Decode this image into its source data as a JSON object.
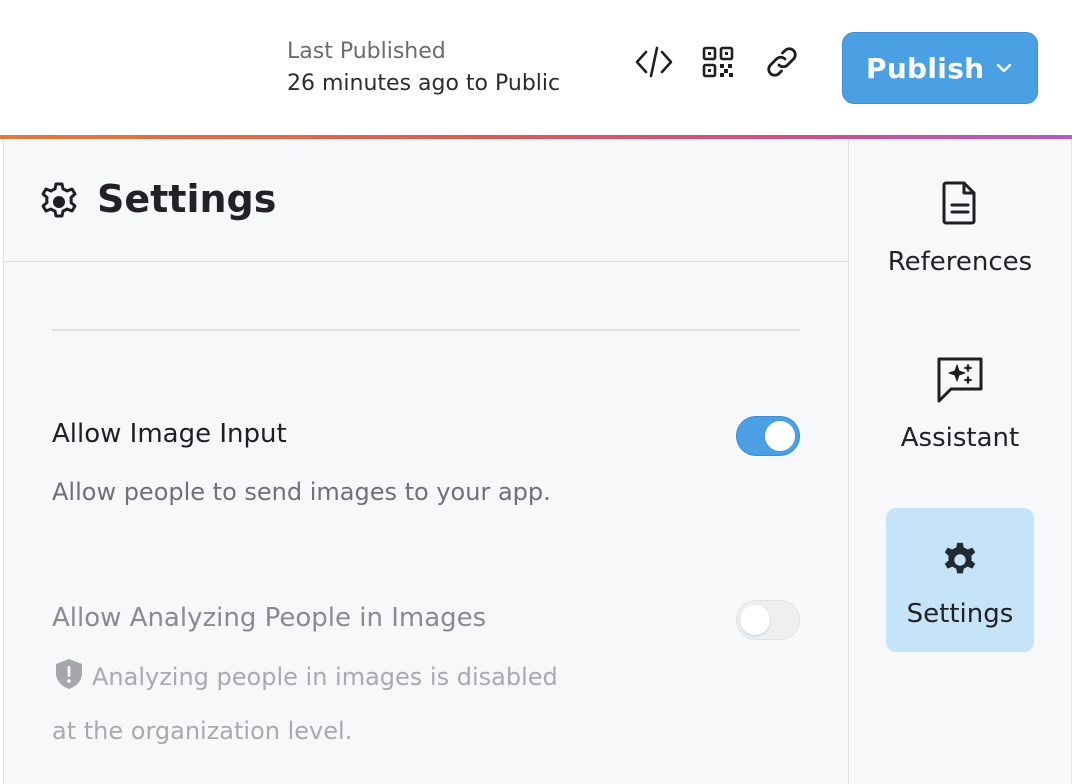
{
  "header": {
    "last_published_label": "Last Published",
    "publish_status": "26 minutes ago to Public",
    "icons": [
      "code-icon",
      "qr-code-icon",
      "link-icon"
    ],
    "publish_button": {
      "label": "Publish",
      "color": "#4b9fe3"
    }
  },
  "panel": {
    "title": "Settings",
    "settings": [
      {
        "title": "Allow Image Input",
        "description": "Allow people to send images to your app.",
        "enabled": true,
        "disabled": false
      },
      {
        "title": "Allow Analyzing People in Images",
        "description_line1": "Analyzing people in images is disabled",
        "description_line2": "at the organization level.",
        "enabled": false,
        "disabled": true
      }
    ]
  },
  "sidebar": {
    "items": [
      {
        "label": "References",
        "icon": "document-icon",
        "active": false
      },
      {
        "label": "Assistant",
        "icon": "sparkle-chat-icon",
        "active": false
      },
      {
        "label": "Settings",
        "icon": "gear-icon",
        "active": true
      }
    ],
    "active_color": "#c6e4f8"
  },
  "colors": {
    "accent": "#4b9fe3",
    "gradient": [
      "#e07a3b",
      "#dc5a55",
      "#cf4f8a",
      "#b65bc0"
    ]
  }
}
